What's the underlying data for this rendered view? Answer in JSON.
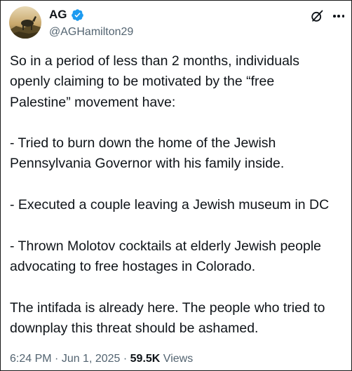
{
  "author": {
    "name": "AG",
    "handle": "@AGHamilton29",
    "verified": true
  },
  "icons": {
    "avatar": "avatar-photo",
    "verified": "verified-badge-icon",
    "grok": "grok-icon",
    "more": "more-options-icon"
  },
  "colors": {
    "verified_blue": "#1d9bf0",
    "text_primary": "#0f1419",
    "text_secondary": "#536471"
  },
  "tweet": {
    "lines": [
      [
        "So in a period of less than 2 months, individuals",
        "openly claiming to be motivated by the “free",
        "Palestine” movement have:"
      ],
      [
        "- Tried to burn down the home of the Jewish",
        "Pennsylvania Governor with his family inside."
      ],
      [
        "- Executed a couple leaving a Jewish museum in DC"
      ],
      [
        "- Thrown Molotov cocktails at elderly Jewish people",
        "advocating to free hostages in Colorado."
      ],
      [
        "The intifada is already here. The people who tried to",
        "downplay this threat should be ashamed."
      ]
    ]
  },
  "meta": {
    "time": "6:24 PM",
    "separator1": " · ",
    "date": "Jun 1, 2025",
    "separator2": " · ",
    "views_count": "59.5K",
    "views_label": " Views"
  }
}
